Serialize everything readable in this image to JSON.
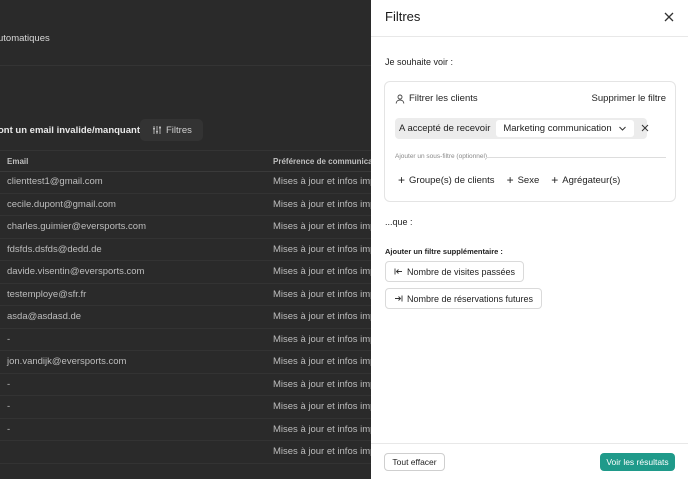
{
  "background": {
    "header_title": "utomatiques",
    "section_title": "ont un email invalide/manquant)",
    "filter_button_label": "Filtres",
    "table": {
      "columns": [
        "Email",
        "Préférence de communicatio"
      ],
      "rows": [
        [
          "clienttest1@gmail.com",
          "Mises à jour et infos impo"
        ],
        [
          "cecile.dupont@gmail.com",
          "Mises à jour et infos impo"
        ],
        [
          "charles.guimier@eversports.com",
          "Mises à jour et infos impo"
        ],
        [
          "fdsfds.dsfds@dedd.de",
          "Mises à jour et infos impo"
        ],
        [
          "davide.visentin@eversports.com",
          "Mises à jour et infos impo"
        ],
        [
          "testemploye@sfr.fr",
          "Mises à jour et infos impo"
        ],
        [
          "asda@asdasd.de",
          "Mises à jour et infos impo"
        ],
        [
          "-",
          "Mises à jour et infos impo"
        ],
        [
          "jon.vandijk@eversports.com",
          "Mises à jour et infos impo"
        ],
        [
          "-",
          "Mises à jour et infos impo"
        ],
        [
          "-",
          "Mises à jour et infos impo"
        ],
        [
          "-",
          "Mises à jour et infos impo"
        ],
        [
          "",
          "Mises à jour et infos impo"
        ]
      ]
    }
  },
  "drawer": {
    "title": "Filtres",
    "intro": "Je souhaite voir :",
    "client_filter": {
      "label": "Filtrer les clients",
      "remove_label": "Supprimer le filtre",
      "condition_label": "A accepté de recevoir",
      "condition_value": "Marketing communication",
      "sub_filter_label": "Ajouter un sous-filtre (optionnel)",
      "add_options": [
        "Groupe(s) de clients",
        "Sexe",
        "Agrégateur(s)"
      ]
    },
    "que_label": "...que :",
    "extra_title": "Ajouter un filtre supplémentaire :",
    "extra_buttons": [
      "Nombre de visites passées",
      "Nombre de réservations futures"
    ],
    "footer": {
      "clear_label": "Tout effacer",
      "results_label": "Voir les résultats"
    }
  },
  "colors": {
    "accent": "#1f9a8a",
    "overlay_bg": "#2a2a2a"
  }
}
